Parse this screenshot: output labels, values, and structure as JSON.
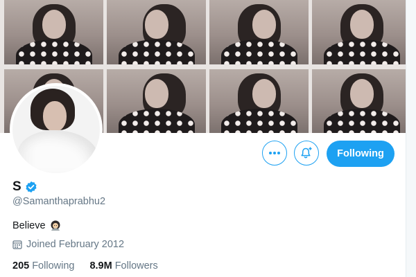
{
  "profile": {
    "display_name": "S",
    "handle": "@Samanthaprabhu2",
    "bio": "Believe",
    "bio_emoji": "person-with-headscarf-emoji",
    "joined": "Joined February 2012",
    "verified": true
  },
  "stats": {
    "following_count": "205",
    "following_label": "Following",
    "followers_count": "8.9M",
    "followers_label": "Followers"
  },
  "actions": {
    "more_icon": "more-horizontal-icon",
    "notify_icon": "bell-plus-icon",
    "following_button": "Following"
  },
  "colors": {
    "accent": "#1da1f2",
    "secondary_text": "#657786",
    "primary_text": "#14171a"
  }
}
